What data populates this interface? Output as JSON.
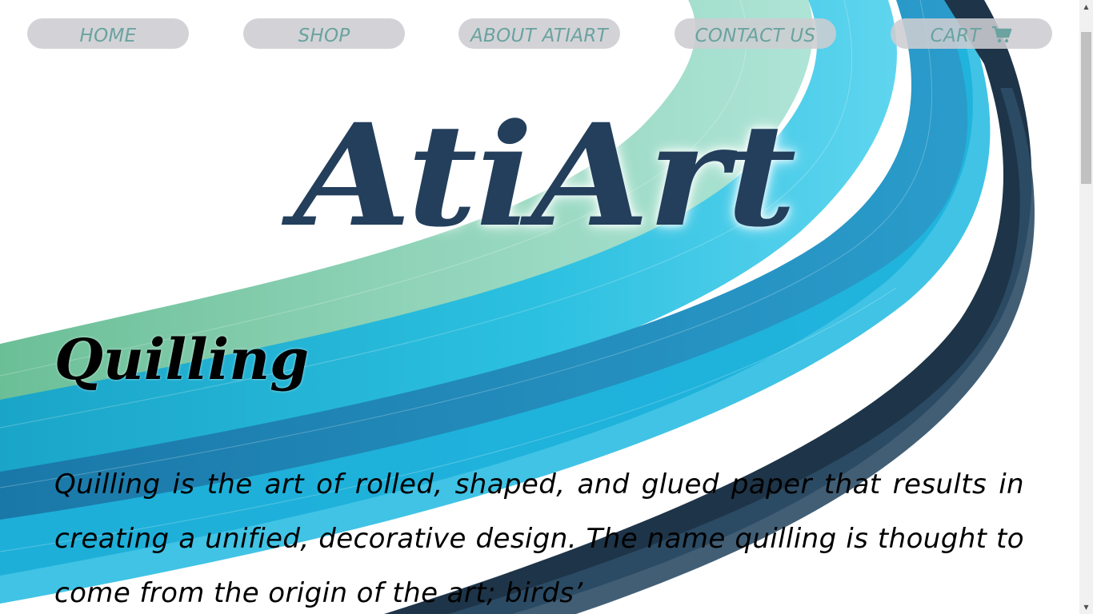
{
  "nav": {
    "items": [
      {
        "label": "HOME"
      },
      {
        "label": "SHOP"
      },
      {
        "label": "ABOUT ATIART"
      },
      {
        "label": "CONTACT US"
      },
      {
        "label": "CART"
      }
    ],
    "cart_icon": "shopping-cart-icon"
  },
  "logo": {
    "text": "AtiArt"
  },
  "section": {
    "title": "Quilling",
    "text": "Quilling is the art of rolled, shaped, and glued paper that results in creating a unified, decorative design. The name quilling is thought to come from the origin of the art; birds’"
  },
  "colors": {
    "logo": "#233f5c",
    "nav_text": "#6aa3a0",
    "nav_bg": "#cdcdd2",
    "strip_teal": "#27b7d8",
    "strip_mint": "#7bc8a8",
    "strip_navy": "#1e3448"
  },
  "scrollbar": {
    "up_icon": "scroll-up-arrow-icon",
    "down_icon": "scroll-down-arrow-icon"
  }
}
